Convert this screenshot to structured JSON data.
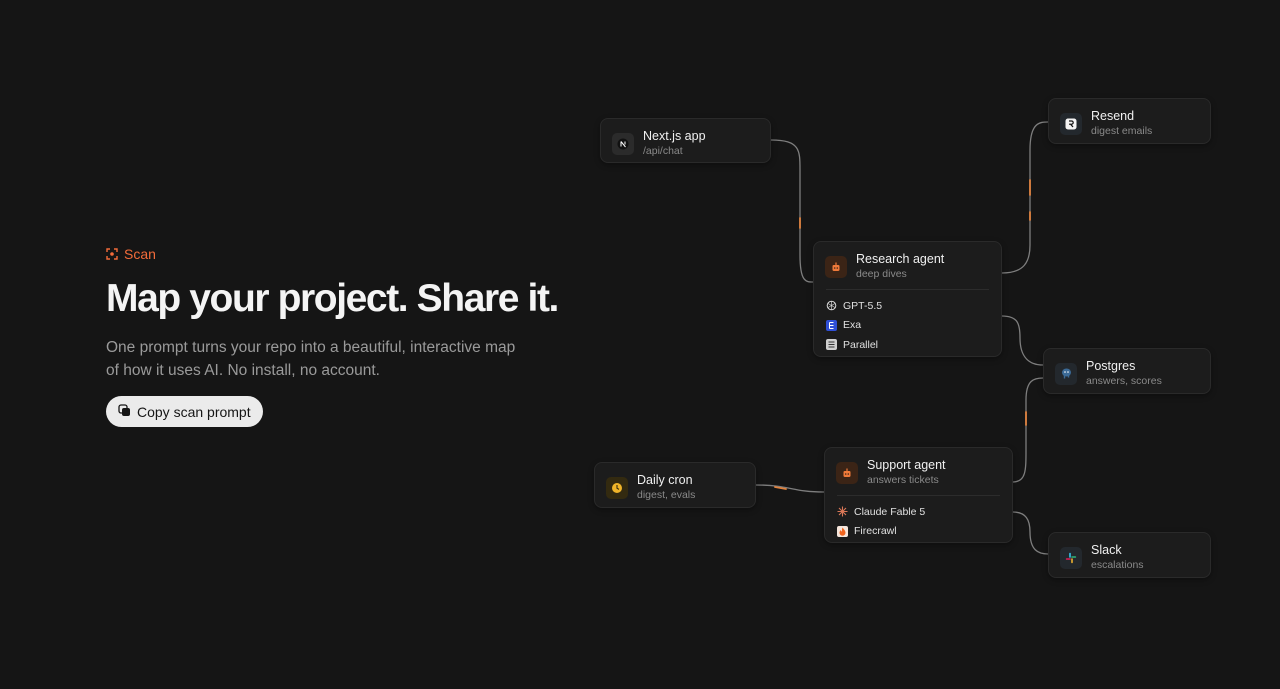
{
  "hero": {
    "eyebrow": "Scan",
    "headline": "Map your project. Share it.",
    "subtitle": "One prompt turns your repo into a beautiful, interactive map of how it uses AI. No install, no account.",
    "cta_label": "Copy scan prompt"
  },
  "colors": {
    "background": "#151515",
    "accent": "#f26b3a",
    "edge": "#8a8a8a",
    "edge_highlight": "#e0833f"
  },
  "diagram": {
    "nodes": {
      "nextjs": {
        "title": "Next.js app",
        "subtitle": "/api/chat",
        "icon": "nextjs-icon"
      },
      "research": {
        "title": "Research agent",
        "subtitle": "deep dives",
        "icon": "agent-icon",
        "tools": [
          {
            "label": "GPT-5.5",
            "icon": "openai-icon"
          },
          {
            "label": "Exa",
            "icon": "exa-icon"
          },
          {
            "label": "Parallel",
            "icon": "parallel-icon"
          }
        ]
      },
      "resend": {
        "title": "Resend",
        "subtitle": "digest emails",
        "icon": "resend-icon"
      },
      "postgres": {
        "title": "Postgres",
        "subtitle": "answers, scores",
        "icon": "postgres-icon"
      },
      "cron": {
        "title": "Daily cron",
        "subtitle": "digest, evals",
        "icon": "clock-icon"
      },
      "support": {
        "title": "Support agent",
        "subtitle": "answers tickets",
        "icon": "agent-icon",
        "tools": [
          {
            "label": "Claude Fable 5",
            "icon": "claude-icon"
          },
          {
            "label": "Firecrawl",
            "icon": "firecrawl-icon"
          }
        ]
      },
      "slack": {
        "title": "Slack",
        "subtitle": "escalations",
        "icon": "slack-icon"
      }
    }
  }
}
